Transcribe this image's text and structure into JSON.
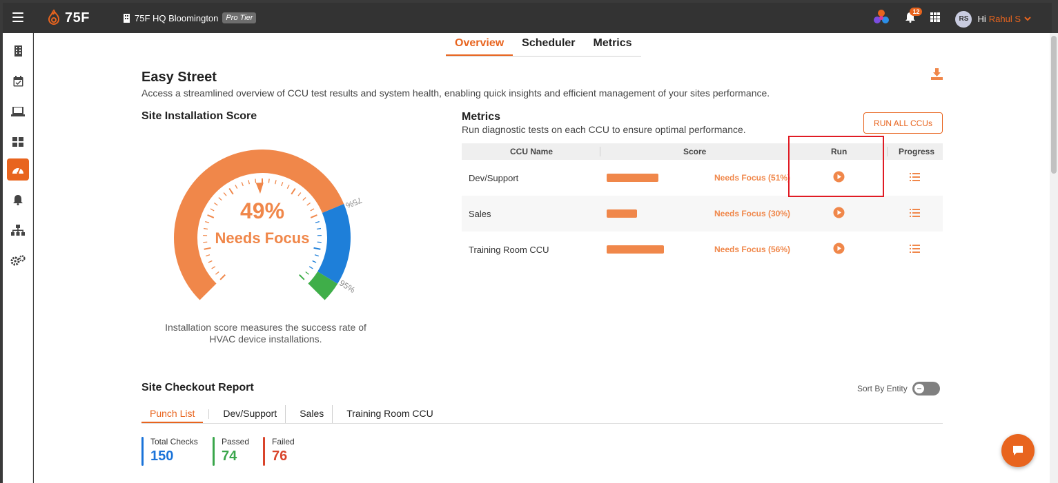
{
  "header": {
    "brand": "75F",
    "site_name": "75F HQ Bloomington",
    "tier": "Pro Tier",
    "notification_count": "12",
    "avatar_initials": "RS",
    "greeting": "Hi",
    "user_name": "Rahul S"
  },
  "tabs": [
    "Overview",
    "Scheduler",
    "Metrics"
  ],
  "page": {
    "title": "Easy Street",
    "description": "Access a streamlined overview of CCU test results and system health, enabling quick insights and efficient management of your sites performance."
  },
  "installation": {
    "title": "Site Installation Score",
    "percent": "49%",
    "status": "Needs Focus",
    "mark_75": "75%",
    "mark_95": "95%",
    "caption": "Installation score measures the success rate of HVAC device installations."
  },
  "metrics": {
    "title": "Metrics",
    "description": "Run diagnostic tests on each CCU to ensure optimal performance.",
    "run_all_label": "RUN ALL CCUs",
    "columns": [
      "CCU Name",
      "Score",
      "Run",
      "Progress"
    ],
    "rows": [
      {
        "name": "Dev/Support",
        "score": 51,
        "status": "Needs Focus (51%)"
      },
      {
        "name": "Sales",
        "score": 30,
        "status": "Needs Focus (30%)"
      },
      {
        "name": "Training Room CCU",
        "score": 56,
        "status": "Needs Focus (56%)"
      }
    ]
  },
  "checkout": {
    "title": "Site Checkout Report",
    "sort_label": "Sort By Entity",
    "subtabs": [
      "Punch List",
      "Dev/Support",
      "Sales",
      "Training Room CCU"
    ],
    "stats": [
      {
        "label": "Total Checks",
        "value": "150",
        "color": "#1a73d9"
      },
      {
        "label": "Passed",
        "value": "74",
        "color": "#3aa64b"
      },
      {
        "label": "Failed",
        "value": "76",
        "color": "#d9442b"
      }
    ]
  },
  "colors": {
    "accent": "#e8641e",
    "gauge_orange": "#f0874a",
    "gauge_blue": "#1e7fd9",
    "gauge_green": "#3fae49"
  }
}
